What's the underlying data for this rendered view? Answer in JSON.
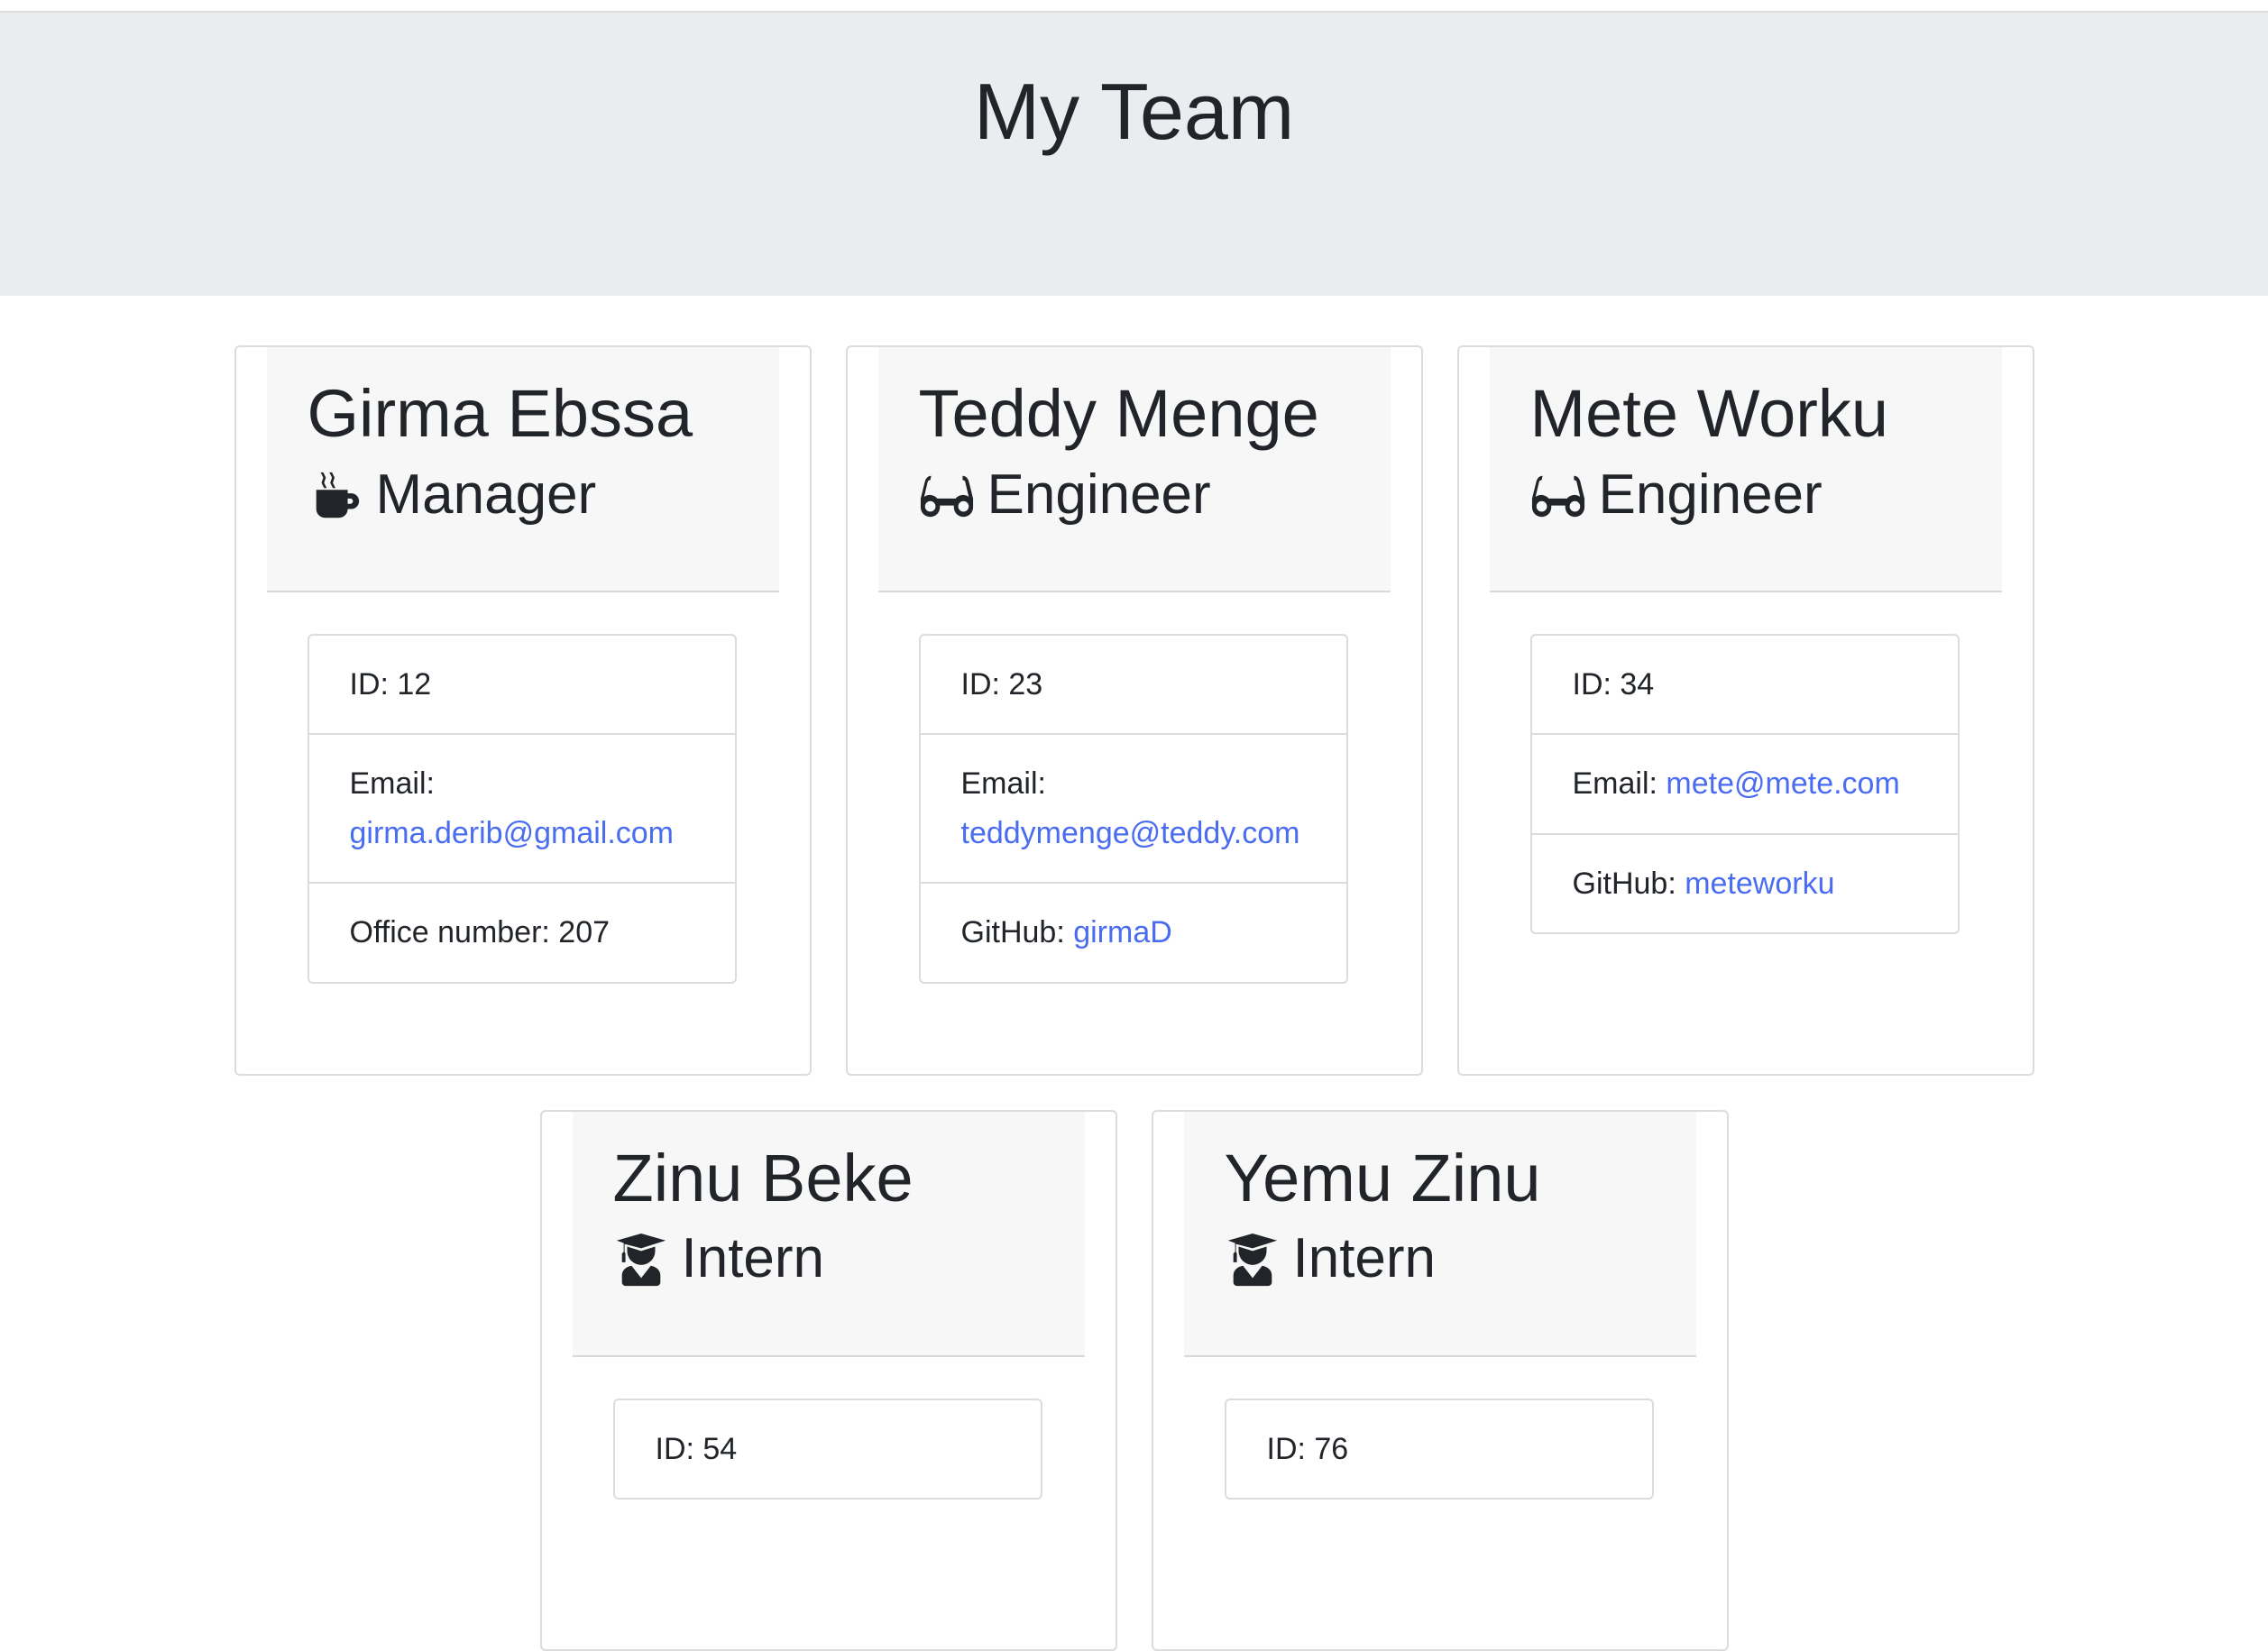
{
  "header": {
    "title": "My Team"
  },
  "colors": {
    "link": "#4a6cf0",
    "header_bg": "#ebecf0",
    "card_header_bg": "#f7f7f7",
    "text": "#212529"
  },
  "employees": [
    {
      "name": "Girma Ebssa",
      "role": "Manager",
      "icon": "mug-hot-icon",
      "id_label": "ID: 12",
      "email_label": "Email:",
      "email": "girma.derib@gmail.com",
      "extra_label": "Office number: 207",
      "extra_link": ""
    },
    {
      "name": "Teddy Menge",
      "role": "Engineer",
      "icon": "glasses-icon",
      "id_label": "ID: 23",
      "email_label": "Email:",
      "email": "teddymenge@teddy.com",
      "extra_label": "GitHub:",
      "extra_link": "girmaD"
    },
    {
      "name": "Mete Worku",
      "role": "Engineer",
      "icon": "glasses-icon",
      "id_label": "ID: 34",
      "email_label": "Email:",
      "email": "mete@mete.com",
      "extra_label": "GitHub:",
      "extra_link": "meteworku"
    },
    {
      "name": "Zinu Beke",
      "role": "Intern",
      "icon": "user-graduate-icon",
      "id_label": "ID: 54"
    },
    {
      "name": "Yemu Zinu",
      "role": "Intern",
      "icon": "user-graduate-icon",
      "id_label": "ID: 76"
    }
  ]
}
